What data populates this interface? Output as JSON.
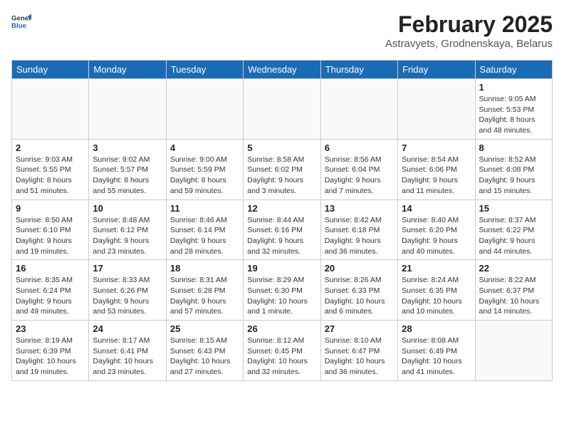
{
  "logo": {
    "general": "General",
    "blue": "Blue"
  },
  "title": "February 2025",
  "subtitle": "Astravyets, Grodnenskaya, Belarus",
  "days_of_week": [
    "Sunday",
    "Monday",
    "Tuesday",
    "Wednesday",
    "Thursday",
    "Friday",
    "Saturday"
  ],
  "weeks": [
    [
      {
        "day": "",
        "info": ""
      },
      {
        "day": "",
        "info": ""
      },
      {
        "day": "",
        "info": ""
      },
      {
        "day": "",
        "info": ""
      },
      {
        "day": "",
        "info": ""
      },
      {
        "day": "",
        "info": ""
      },
      {
        "day": "1",
        "info": "Sunrise: 9:05 AM\nSunset: 5:53 PM\nDaylight: 8 hours\nand 48 minutes."
      }
    ],
    [
      {
        "day": "2",
        "info": "Sunrise: 9:03 AM\nSunset: 5:55 PM\nDaylight: 8 hours\nand 51 minutes."
      },
      {
        "day": "3",
        "info": "Sunrise: 9:02 AM\nSunset: 5:57 PM\nDaylight: 8 hours\nand 55 minutes."
      },
      {
        "day": "4",
        "info": "Sunrise: 9:00 AM\nSunset: 5:59 PM\nDaylight: 8 hours\nand 59 minutes."
      },
      {
        "day": "5",
        "info": "Sunrise: 8:58 AM\nSunset: 6:02 PM\nDaylight: 9 hours\nand 3 minutes."
      },
      {
        "day": "6",
        "info": "Sunrise: 8:56 AM\nSunset: 6:04 PM\nDaylight: 9 hours\nand 7 minutes."
      },
      {
        "day": "7",
        "info": "Sunrise: 8:54 AM\nSunset: 6:06 PM\nDaylight: 9 hours\nand 11 minutes."
      },
      {
        "day": "8",
        "info": "Sunrise: 8:52 AM\nSunset: 6:08 PM\nDaylight: 9 hours\nand 15 minutes."
      }
    ],
    [
      {
        "day": "9",
        "info": "Sunrise: 8:50 AM\nSunset: 6:10 PM\nDaylight: 9 hours\nand 19 minutes."
      },
      {
        "day": "10",
        "info": "Sunrise: 8:48 AM\nSunset: 6:12 PM\nDaylight: 9 hours\nand 23 minutes."
      },
      {
        "day": "11",
        "info": "Sunrise: 8:46 AM\nSunset: 6:14 PM\nDaylight: 9 hours\nand 28 minutes."
      },
      {
        "day": "12",
        "info": "Sunrise: 8:44 AM\nSunset: 6:16 PM\nDaylight: 9 hours\nand 32 minutes."
      },
      {
        "day": "13",
        "info": "Sunrise: 8:42 AM\nSunset: 6:18 PM\nDaylight: 9 hours\nand 36 minutes."
      },
      {
        "day": "14",
        "info": "Sunrise: 8:40 AM\nSunset: 6:20 PM\nDaylight: 9 hours\nand 40 minutes."
      },
      {
        "day": "15",
        "info": "Sunrise: 8:37 AM\nSunset: 6:22 PM\nDaylight: 9 hours\nand 44 minutes."
      }
    ],
    [
      {
        "day": "16",
        "info": "Sunrise: 8:35 AM\nSunset: 6:24 PM\nDaylight: 9 hours\nand 49 minutes."
      },
      {
        "day": "17",
        "info": "Sunrise: 8:33 AM\nSunset: 6:26 PM\nDaylight: 9 hours\nand 53 minutes."
      },
      {
        "day": "18",
        "info": "Sunrise: 8:31 AM\nSunset: 6:28 PM\nDaylight: 9 hours\nand 57 minutes."
      },
      {
        "day": "19",
        "info": "Sunrise: 8:29 AM\nSunset: 6:30 PM\nDaylight: 10 hours\nand 1 minute."
      },
      {
        "day": "20",
        "info": "Sunrise: 8:26 AM\nSunset: 6:33 PM\nDaylight: 10 hours\nand 6 minutes."
      },
      {
        "day": "21",
        "info": "Sunrise: 8:24 AM\nSunset: 6:35 PM\nDaylight: 10 hours\nand 10 minutes."
      },
      {
        "day": "22",
        "info": "Sunrise: 8:22 AM\nSunset: 6:37 PM\nDaylight: 10 hours\nand 14 minutes."
      }
    ],
    [
      {
        "day": "23",
        "info": "Sunrise: 8:19 AM\nSunset: 6:39 PM\nDaylight: 10 hours\nand 19 minutes."
      },
      {
        "day": "24",
        "info": "Sunrise: 8:17 AM\nSunset: 6:41 PM\nDaylight: 10 hours\nand 23 minutes."
      },
      {
        "day": "25",
        "info": "Sunrise: 8:15 AM\nSunset: 6:43 PM\nDaylight: 10 hours\nand 27 minutes."
      },
      {
        "day": "26",
        "info": "Sunrise: 8:12 AM\nSunset: 6:45 PM\nDaylight: 10 hours\nand 32 minutes."
      },
      {
        "day": "27",
        "info": "Sunrise: 8:10 AM\nSunset: 6:47 PM\nDaylight: 10 hours\nand 36 minutes."
      },
      {
        "day": "28",
        "info": "Sunrise: 8:08 AM\nSunset: 6:49 PM\nDaylight: 10 hours\nand 41 minutes."
      },
      {
        "day": "",
        "info": ""
      }
    ]
  ]
}
